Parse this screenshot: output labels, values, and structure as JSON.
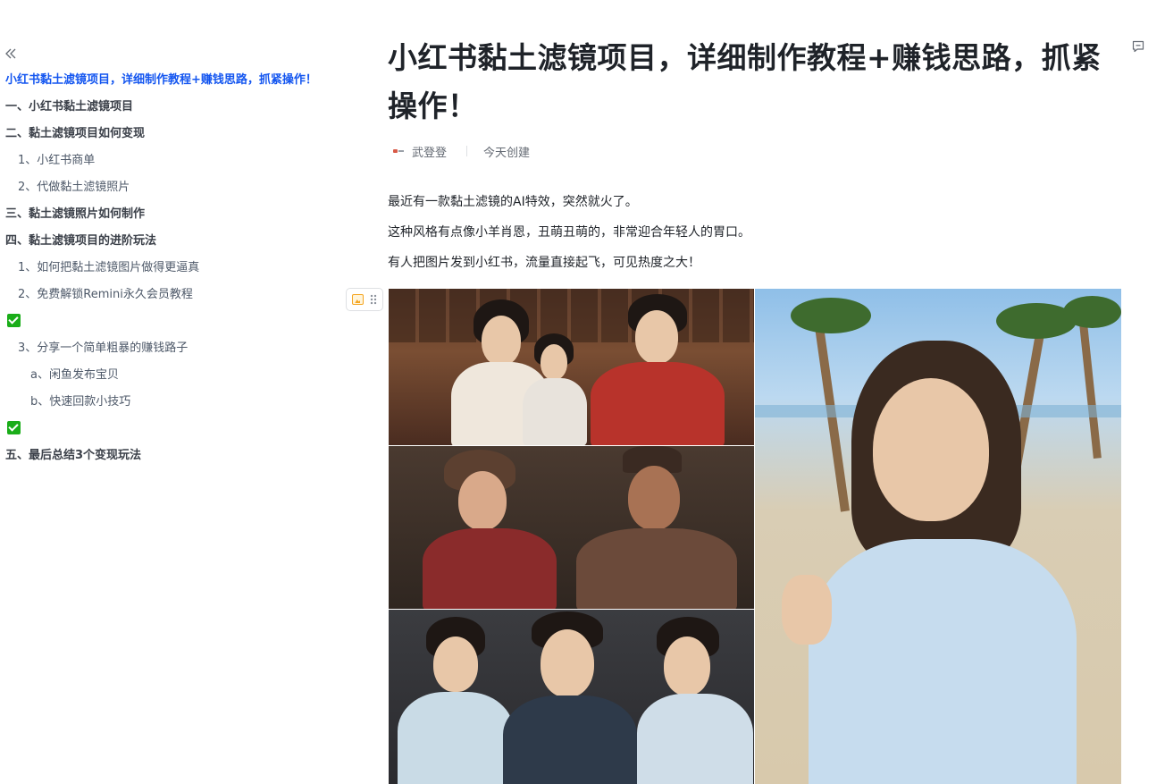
{
  "outline": {
    "collapse_icon": "double-chevron-left-icon",
    "items": [
      {
        "label": "小红书黏土滤镜项目，详细制作教程+赚钱思路，抓紧操作！",
        "level": 1,
        "active": true
      },
      {
        "label": "一、小红书黏土滤镜项目",
        "level": 1
      },
      {
        "label": "二、黏土滤镜项目如何变现",
        "level": 1
      },
      {
        "label": "1、小红书商单",
        "level": 2
      },
      {
        "label": "2、代做黏土滤镜照片",
        "level": 2
      },
      {
        "label": "三、黏土滤镜照片如何制作",
        "level": 1
      },
      {
        "label": "四、黏土滤镜项目的进阶玩法",
        "level": 1
      },
      {
        "label": "1、如何把黏土滤镜图片做得更逼真",
        "level": 2
      },
      {
        "label": "2、免费解锁Remini永久会员教程",
        "level": 2
      },
      {
        "label": "",
        "icon": "check-mark-button-icon"
      },
      {
        "label": "3、分享一个简单粗暴的赚钱路子",
        "level": 2
      },
      {
        "label": "a、闲鱼发布宝贝",
        "level": 3
      },
      {
        "label": "b、快速回款小技巧",
        "level": 3
      },
      {
        "label": "",
        "icon": "check-mark-button-icon"
      },
      {
        "label": "五、最后总结3个变现玩法",
        "level": 1
      }
    ]
  },
  "document": {
    "title": "小红书黏土滤镜项目，详细制作教程+赚钱思路，抓紧操作！",
    "author": "武登登",
    "created": "今天创建",
    "paragraphs": [
      "最近有一款黏土滤镜的AI特效，突然就火了。",
      "这种风格有点像小羊肖恩，丑萌丑萌的，非常迎合年轻人的胃口。",
      "有人把图片发到小红书，流量直接起飞，可见热度之大！"
    ],
    "image": {
      "description_icon": "image-block-icon",
      "panels": [
        "qing-court-clay-figures-top",
        "qing-court-clay-figures-middle",
        "qing-court-clay-figures-bottom",
        "beach-clay-girl"
      ]
    }
  },
  "colors": {
    "accent": "#1456f0",
    "text": "#1f2329",
    "muted": "#646a73",
    "check": "#1aad19"
  }
}
